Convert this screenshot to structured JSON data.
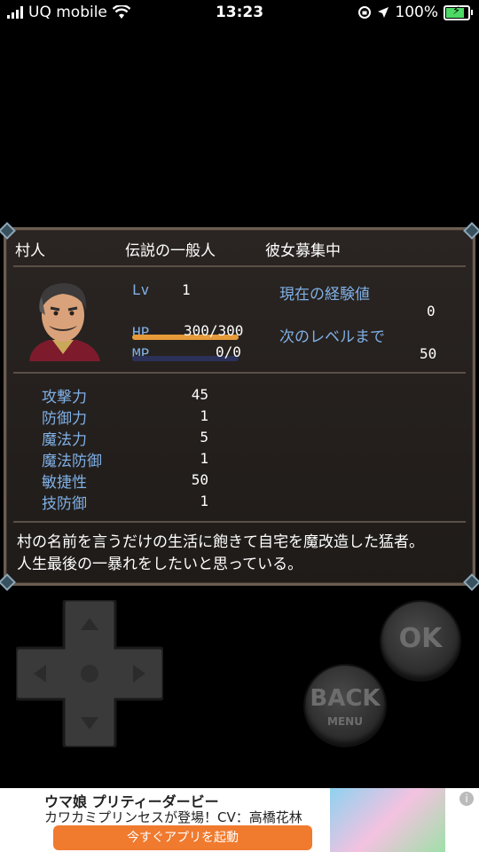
{
  "status_bar": {
    "carrier": "UQ mobile",
    "time": "13:23",
    "battery_percent": "100%",
    "battery_level": 1.0
  },
  "header": {
    "name": "村人",
    "title": "伝説の一般人",
    "subtitle": "彼女募集中"
  },
  "level": {
    "label": "Lv",
    "value": "1"
  },
  "hp": {
    "label": "HP",
    "value": "300/300",
    "fill": 1.0,
    "color": "#e79a3a"
  },
  "mp": {
    "label": "MP",
    "value": "0/0",
    "fill": 0.0,
    "color": "#37477a"
  },
  "exp": {
    "current_label": "現在の経験値",
    "current_value": "0",
    "next_label": "次のレベルまで",
    "next_value": "50"
  },
  "stats": [
    {
      "label": "攻撃力",
      "value": "45"
    },
    {
      "label": "防御力",
      "value": "1"
    },
    {
      "label": "魔法力",
      "value": "5"
    },
    {
      "label": "魔法防御",
      "value": "1"
    },
    {
      "label": "敏捷性",
      "value": "50"
    },
    {
      "label": "技防御",
      "value": "1"
    }
  ],
  "description": {
    "line1": "村の名前を言うだけの生活に飽きて自宅を魔改造した猛者。",
    "line2": "人生最後の一暴れをしたいと思っている。"
  },
  "controls": {
    "ok_label": "OK",
    "back_label": "BACK",
    "menu_label": "MENU"
  },
  "ad": {
    "title": "ウマ娘 プリティーダービー",
    "subtitle": "カワカミプリンセスが登場！CV：高橋花林",
    "cta": "今すぐアプリを起動",
    "info_icon": "i"
  },
  "icons": [
    "signal-bars-icon",
    "wifi-icon",
    "rotation-lock-icon",
    "location-arrow-icon",
    "battery-charging-icon",
    "character-portrait",
    "dpad-up-icon",
    "dpad-down-icon",
    "dpad-left-icon",
    "dpad-right-icon",
    "info-icon"
  ]
}
